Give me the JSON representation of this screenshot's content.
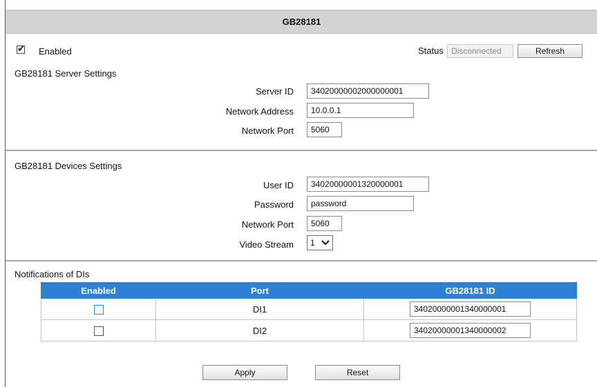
{
  "window": {
    "title": "GB28181"
  },
  "general": {
    "enabled_label": "Enabled",
    "enabled_checked": true,
    "status_label": "Status",
    "status_value": "Disconnected",
    "refresh_label": "Refresh"
  },
  "server": {
    "heading": "GB28181 Server Settings",
    "server_id_label": "Server ID",
    "server_id_value": "34020000002000000001",
    "network_address_label": "Network Address",
    "network_address_value": "10.0.0.1",
    "network_port_label": "Network Port",
    "network_port_value": "5060"
  },
  "devices": {
    "heading": "GB28181 Devices Settings",
    "user_id_label": "User ID",
    "user_id_value": "34020000001320000001",
    "password_label": "Password",
    "password_value": "password",
    "network_port_label": "Network Port",
    "network_port_value": "5060",
    "video_stream_label": "Video Stream",
    "video_stream_value": "1"
  },
  "notifications": {
    "heading": "Notifications of DIs",
    "columns": [
      "Enabled",
      "Port",
      "GB28181 ID"
    ],
    "rows": [
      {
        "enabled": false,
        "port": "DI1",
        "id": "34020000001340000001"
      },
      {
        "enabled": false,
        "port": "DI2",
        "id": "34020000001340000002"
      }
    ]
  },
  "actions": {
    "apply_label": "Apply",
    "reset_label": "Reset"
  }
}
